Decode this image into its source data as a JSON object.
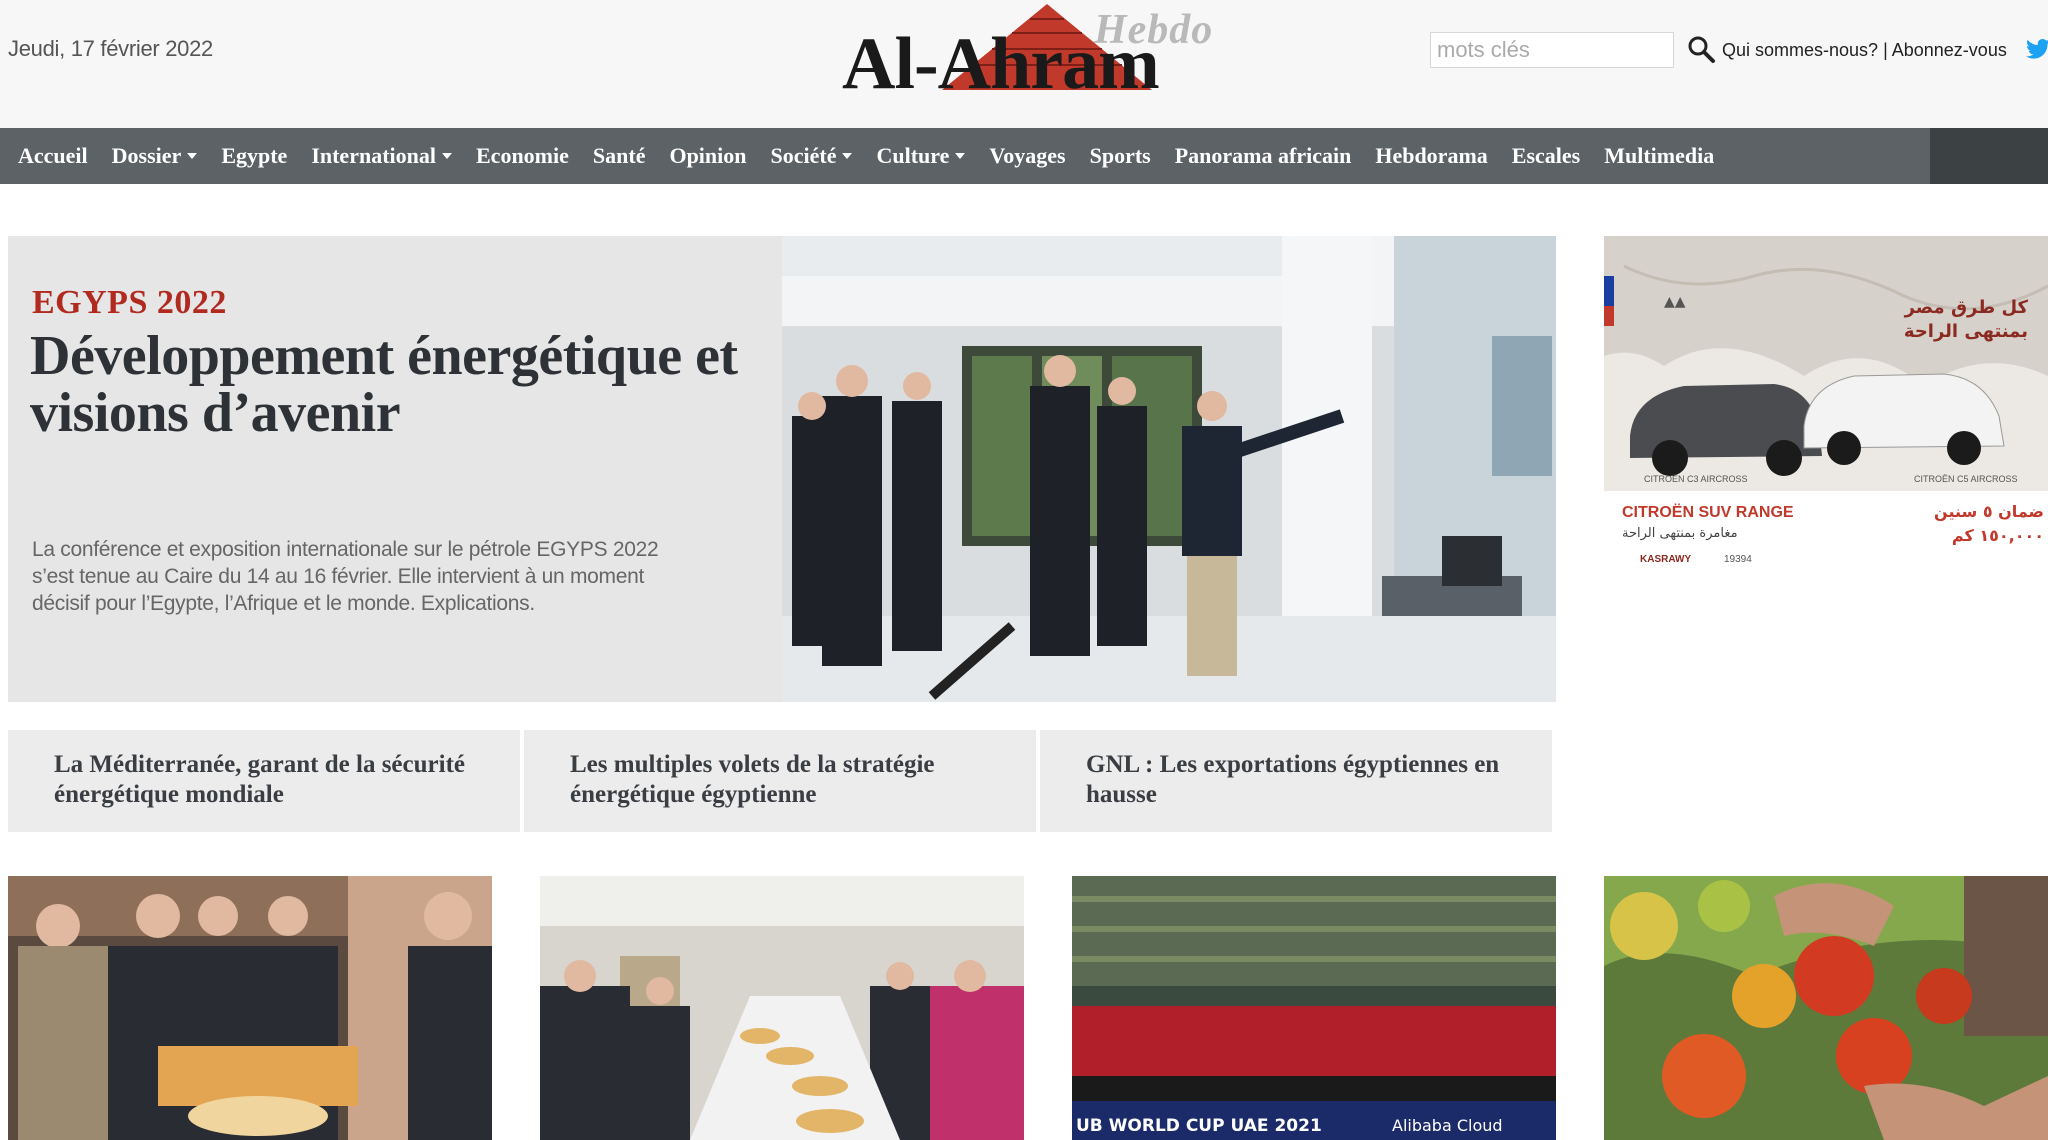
{
  "header": {
    "date": "Jeudi, 17 février 2022",
    "logo_hebdo": "Hebdo",
    "logo_name": "Al-Ahram",
    "search_placeholder": "mots clés",
    "link_about": "Qui sommes-nous?",
    "separator": " | ",
    "link_subscribe": "Abonnez-vous"
  },
  "nav": {
    "items": [
      {
        "label": "Accueil"
      },
      {
        "label": "Dossier"
      },
      {
        "label": "Egypte"
      },
      {
        "label": "International"
      },
      {
        "label": "Economie"
      },
      {
        "label": "Santé"
      },
      {
        "label": "Opinion"
      },
      {
        "label": "Société"
      },
      {
        "label": "Culture"
      },
      {
        "label": "Voyages"
      },
      {
        "label": "Sports"
      },
      {
        "label": "Panorama africain"
      },
      {
        "label": "Hebdorama"
      },
      {
        "label": "Escales"
      },
      {
        "label": "Multimedia"
      }
    ]
  },
  "feature": {
    "kicker": "EGYPS 2022",
    "headline": "Développement énergétique et visions d’avenir",
    "summary": "La conférence et exposition internationale sur le pétrole EGYPS 2022 s’est tenue au Caire du 14 au 16 février. Elle intervient à un moment décisif pour l’Egypte, l’Afrique et le monde. Explications."
  },
  "related": [
    {
      "title": "La Méditerranée, garant de la sécurité énergétique mondiale"
    },
    {
      "title": "Les multiples volets de la stratégie énergétique égyptienne"
    },
    {
      "title": "GNL : Les exportations égyptiennes en hausse"
    }
  ],
  "ad": {
    "arabic_title": "كل طرق مصر بمنتهى الراحة",
    "brand": "CITROËN SUV RANGE",
    "arabic_sub": "مغامرة بمنتهى الراحة",
    "model_left": "CITROËN C3 AIRCROSS",
    "model_right": "CITROËN C5 AIRCROSS",
    "arabic_warranty": "ضمان ٥ سنين",
    "arabic_km": "١٥٠,٠٠٠ كم",
    "dealer": "KASRAWY",
    "hotline": "19394"
  },
  "thumbs": {
    "t3_banner": "UB WORLD CUP UAE 2021",
    "t3_sponsor": "Alibaba Cloud"
  },
  "colors": {
    "nav_bg": "#5c6266",
    "kicker": "#b02a20",
    "headline": "#2e3236",
    "panel": "#e6e6e6"
  }
}
